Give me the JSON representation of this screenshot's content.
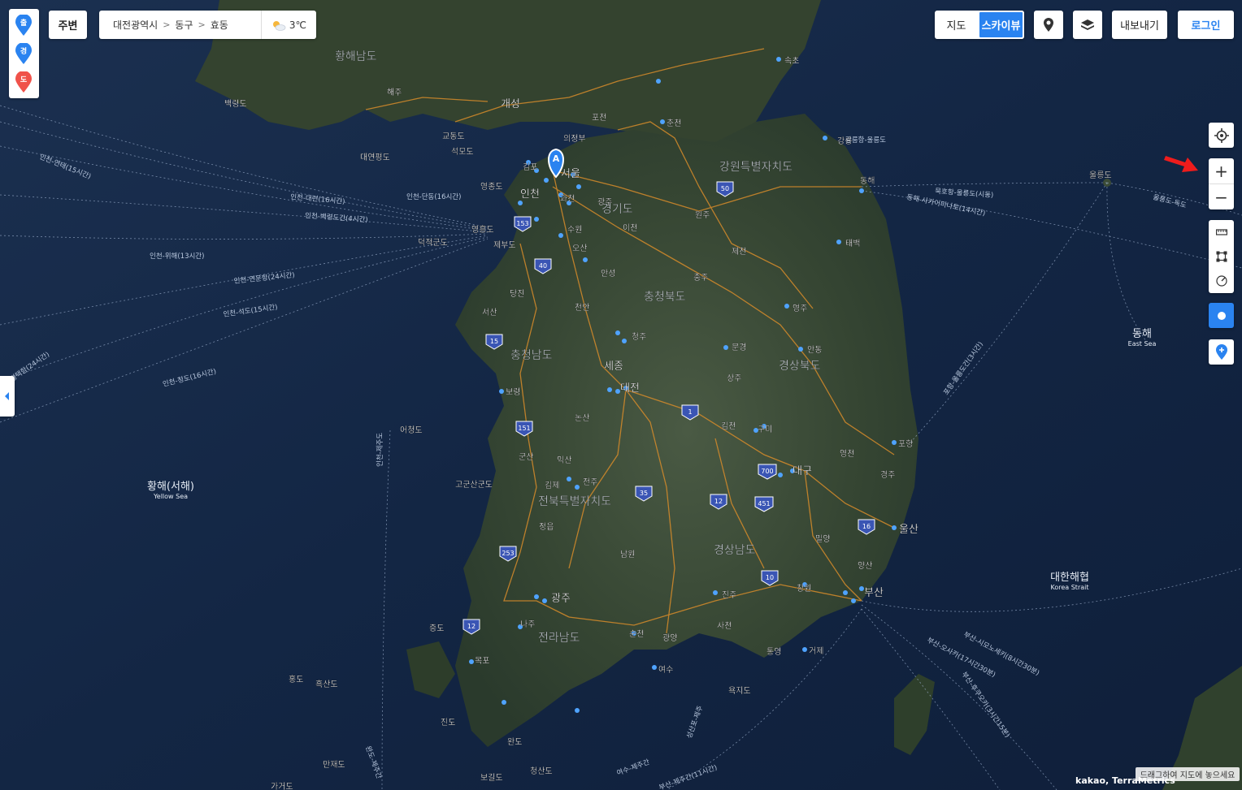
{
  "markers": [
    {
      "char": "출",
      "color": "#2a83f0"
    },
    {
      "char": "경",
      "color": "#2a83f0"
    },
    {
      "char": "도",
      "color": "#f0524a"
    }
  ],
  "toolbar": {
    "nearby": "주변",
    "breadcrumb": [
      "대전광역시",
      "동구",
      "효동"
    ],
    "weather": "3℃",
    "map_type_map": "지도",
    "map_type_sky": "스카이뷰",
    "export": "내보내기",
    "login": "로그인"
  },
  "zoom": {
    "in": "+",
    "out": "−"
  },
  "hint": "드래그하여 지도에 놓으세요",
  "copyright": "kakao, TerraMetrics",
  "colors": {
    "accent": "#2a83f0",
    "sea": "#14294a",
    "land": "#3a4b38",
    "road": "#d68b2a",
    "poi": "#4fa3ff"
  },
  "map": {
    "regions": [
      {
        "name": "강원특별자치도"
      },
      {
        "name": "경기도"
      },
      {
        "name": "충청북도"
      },
      {
        "name": "충청남도"
      },
      {
        "name": "경상북도"
      },
      {
        "name": "경상남도"
      },
      {
        "name": "전북특별자치도"
      },
      {
        "name": "전라남도"
      },
      {
        "name": "황해남도"
      }
    ],
    "cities": [
      {
        "name": "개성"
      },
      {
        "name": "해주"
      },
      {
        "name": "포천"
      },
      {
        "name": "춘천"
      },
      {
        "name": "속초"
      },
      {
        "name": "강릉"
      },
      {
        "name": "동해"
      },
      {
        "name": "태백"
      },
      {
        "name": "원주"
      },
      {
        "name": "제천"
      },
      {
        "name": "충주"
      },
      {
        "name": "영주"
      },
      {
        "name": "안동"
      },
      {
        "name": "문경"
      },
      {
        "name": "상주"
      },
      {
        "name": "김천"
      },
      {
        "name": "구미"
      },
      {
        "name": "영천"
      },
      {
        "name": "포항"
      },
      {
        "name": "경주"
      },
      {
        "name": "대구"
      },
      {
        "name": "울산"
      },
      {
        "name": "밀양"
      },
      {
        "name": "양산"
      },
      {
        "name": "부산"
      },
      {
        "name": "창원"
      },
      {
        "name": "진주"
      },
      {
        "name": "사천"
      },
      {
        "name": "통영"
      },
      {
        "name": "거제"
      },
      {
        "name": "여수"
      },
      {
        "name": "광양"
      },
      {
        "name": "순천"
      },
      {
        "name": "광주"
      },
      {
        "name": "나주"
      },
      {
        "name": "목포"
      },
      {
        "name": "남원"
      },
      {
        "name": "정읍"
      },
      {
        "name": "김제"
      },
      {
        "name": "전주"
      },
      {
        "name": "익산"
      },
      {
        "name": "군산"
      },
      {
        "name": "논산"
      },
      {
        "name": "대전"
      },
      {
        "name": "세종"
      },
      {
        "name": "보령"
      },
      {
        "name": "청주"
      },
      {
        "name": "천안"
      },
      {
        "name": "당진"
      },
      {
        "name": "서산"
      },
      {
        "name": "안성"
      },
      {
        "name": "오산"
      },
      {
        "name": "수원"
      },
      {
        "name": "이천"
      },
      {
        "name": "광주"
      },
      {
        "name": "과천"
      },
      {
        "name": "서울"
      },
      {
        "name": "인천"
      },
      {
        "name": "김포"
      },
      {
        "name": "의정부"
      },
      {
        "name": "제부도"
      },
      {
        "name": "영흥도"
      },
      {
        "name": "영종도"
      },
      {
        "name": "석모도"
      },
      {
        "name": "교동도"
      },
      {
        "name": "대연평도"
      },
      {
        "name": "백령도"
      },
      {
        "name": "덕적군도"
      },
      {
        "name": "어청도"
      },
      {
        "name": "고군산군도"
      },
      {
        "name": "증도"
      },
      {
        "name": "흑산도"
      },
      {
        "name": "홍도"
      },
      {
        "name": "진도"
      },
      {
        "name": "완도"
      },
      {
        "name": "만재도"
      },
      {
        "name": "보길도"
      },
      {
        "name": "청산도"
      },
      {
        "name": "욕지도"
      },
      {
        "name": "울릉도"
      },
      {
        "name": "가거도"
      }
    ],
    "seas": [
      {
        "ko": "황해(서해)",
        "en": "Yellow Sea"
      },
      {
        "ko": "동해",
        "en": "East Sea"
      },
      {
        "ko": "대한해협",
        "en": "Korea Strait"
      }
    ],
    "routes": [
      {
        "label": "인천-연태(15시간)"
      },
      {
        "label": "인천-대련(16시간)"
      },
      {
        "label": "인천-단동(16시간)"
      },
      {
        "label": "인천-백령도간(4시간)"
      },
      {
        "label": "인천-위해(13시간)"
      },
      {
        "label": "인천-연운항(24시간)"
      },
      {
        "label": "인천-석도(15시간)"
      },
      {
        "label": "인천-청도(16시간)"
      },
      {
        "label": "평택항(24시간)"
      },
      {
        "label": "인천-제주도"
      },
      {
        "label": "묵호항-울릉도(시동)"
      },
      {
        "label": "동해-사카이미나토(14시간)"
      },
      {
        "label": "포항-울릉도간(3시간)"
      },
      {
        "label": "부산-시모노세키(8시간30분)"
      },
      {
        "label": "부산-오사카(17시간30분)"
      },
      {
        "label": "부산-후쿠오카(3시간15분)"
      },
      {
        "label": "부산-제주간(11시간)"
      },
      {
        "label": "완도-제주간"
      },
      {
        "label": "성산포-제주"
      },
      {
        "label": "여수-제주간"
      },
      {
        "label": "강릉항-울릉도"
      },
      {
        "label": "울릉도-독도"
      }
    ],
    "highways": [
      "50",
      "153",
      "40",
      "15",
      "151",
      "1",
      "35",
      "253",
      "12",
      "12",
      "700",
      "451",
      "16",
      "10"
    ]
  }
}
